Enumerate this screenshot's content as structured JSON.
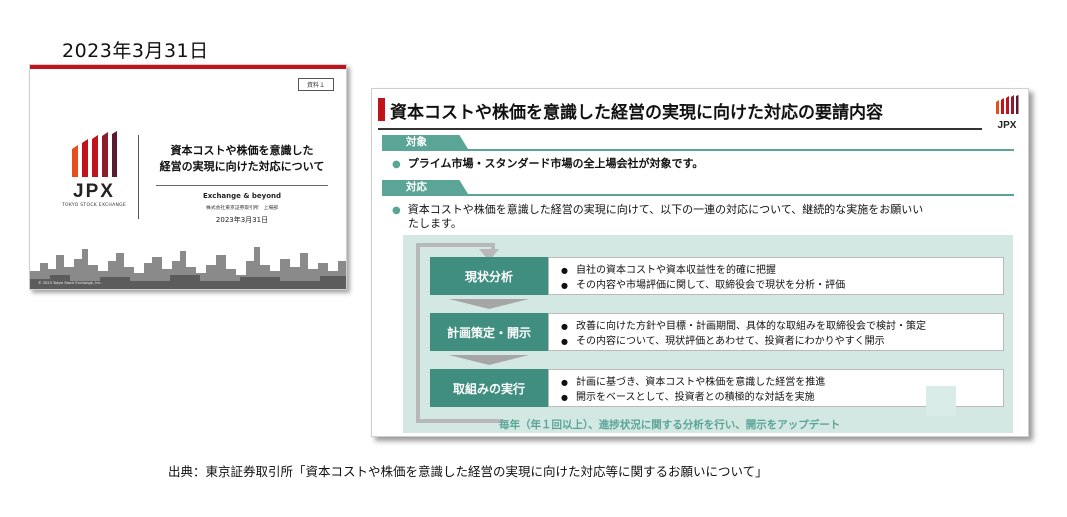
{
  "date_heading": "2023年3月31日",
  "cover_slide": {
    "material_tag": "資料１",
    "logo_text": "JPX",
    "logo_subtext": "TOKYO STOCK EXCHANGE",
    "title_line1": "資本コストや株価を意識した",
    "title_line2": "経営の実現に向けた対応について",
    "tagline": "Exchange & beyond",
    "organization": "株式会社東京証券取引所　上場部",
    "date": "2023年3月31日",
    "copyright": "© 2023 Tokyo Stock Exchange, Inc.",
    "accent_color": "#c0131b"
  },
  "main_slide": {
    "title": "資本コストや株価を意識した経営の実現に向けた対応の要請内容",
    "logo_text": "JPX",
    "sections": [
      {
        "label": "対象",
        "bullets": [
          "プライム市場・スタンダード市場の全上場会社が対象です。"
        ]
      },
      {
        "label": "対応",
        "bullets": [
          "資本コストや株価を意識した経営の実現に向けて、以下の一連の対応について、継続的な実施をお願いい",
          "たします。"
        ]
      }
    ],
    "steps": [
      {
        "label": "現状分析",
        "items": [
          "自社の資本コストや資本収益性を的確に把握",
          "その内容や市場評価に関して、取締役会で現状を分析・評価"
        ]
      },
      {
        "label": "計画策定・開示",
        "items": [
          "改善に向けた方針や目標・計画期間、具体的な取組みを取締役会で検討・策定",
          "その内容について、現状評価とあわせて、投資者にわかりやすく開示"
        ]
      },
      {
        "label": "取組みの実行",
        "items": [
          "計画に基づき、資本コストや株価を意識した経営を推進",
          "開示をベースとして、投資者との積極的な対話を実施"
        ]
      }
    ],
    "annual_note": "毎年（年１回以上）、進捗状況に関する分析を行い、開示をアップデート",
    "accent_color": "#5aa595",
    "step_color": "#3f8e7f"
  },
  "source": "出典：東京証券取引所「資本コストや株価を意識した経営の実現に向けた対応等に関するお願いについて」"
}
